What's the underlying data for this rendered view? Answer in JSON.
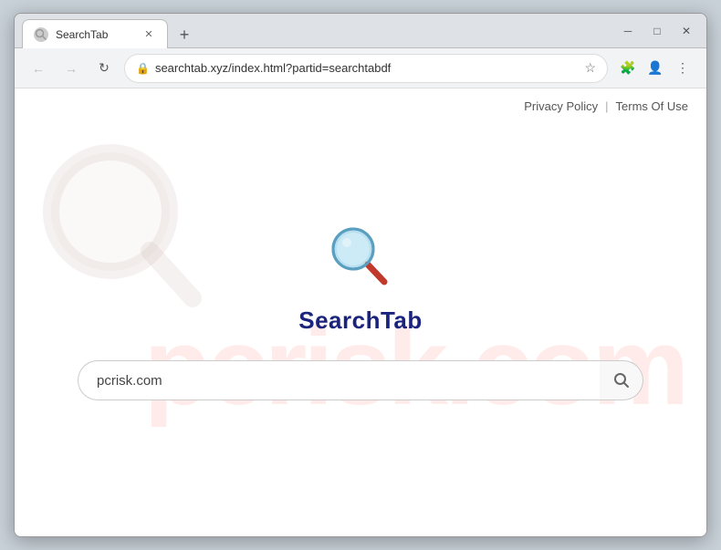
{
  "browser": {
    "tab_title": "SearchTab",
    "tab_favicon": "🔍",
    "url": "searchtab.xyz/index.html?partid=searchtabdf",
    "new_tab_label": "+",
    "win_minimize": "─",
    "win_restore": "□",
    "win_close": "✕",
    "nav_back": "←",
    "nav_forward": "→",
    "nav_reload": "↻",
    "lock_icon": "🔒"
  },
  "page": {
    "privacy_policy_label": "Privacy Policy",
    "separator": "|",
    "terms_of_use_label": "Terms Of Use",
    "site_name": "SearchTab",
    "search_placeholder": "pcrisk.com",
    "watermark_text": "pcrisk.com"
  },
  "nav_icons": {
    "extensions": "🧩",
    "profile": "👤",
    "menu": "⋮",
    "star": "☆"
  }
}
